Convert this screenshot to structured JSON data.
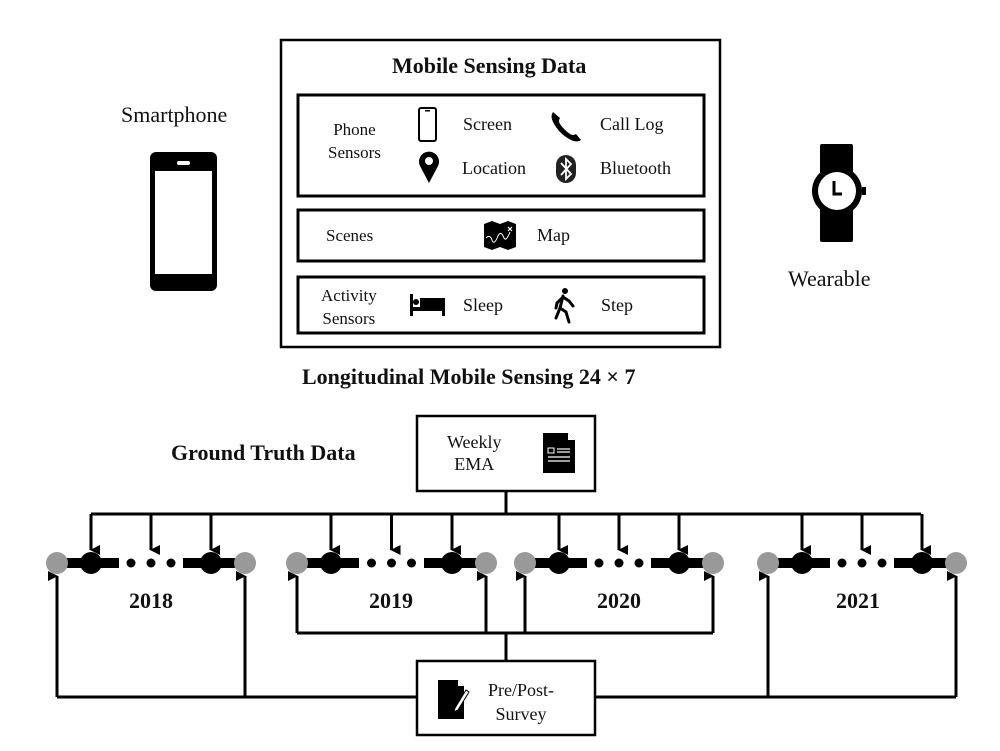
{
  "smartphone": {
    "label": "Smartphone",
    "icon": "smartphone-icon"
  },
  "wearable": {
    "label": "Wearable",
    "icon": "watch-icon"
  },
  "mobile_sensing": {
    "title": "Mobile Sensing Data",
    "groups": [
      {
        "label_lines": [
          "Phone",
          "Sensors"
        ],
        "items": [
          {
            "label": "Screen",
            "icon": "phone-screen-icon"
          },
          {
            "label": "Call Log",
            "icon": "phone-call-icon"
          },
          {
            "label": "Location",
            "icon": "location-pin-icon"
          },
          {
            "label": "Bluetooth",
            "icon": "bluetooth-icon"
          }
        ]
      },
      {
        "label_lines": [
          "Scenes"
        ],
        "items": [
          {
            "label": "Map",
            "icon": "map-icon"
          }
        ]
      },
      {
        "label_lines": [
          "Activity",
          "Sensors"
        ],
        "items": [
          {
            "label": "Sleep",
            "icon": "bed-icon"
          },
          {
            "label": "Step",
            "icon": "walking-icon"
          }
        ]
      }
    ],
    "caption": "Longitudinal Mobile Sensing 24 × 7"
  },
  "ground_truth": {
    "title": "Ground Truth Data",
    "weekly_ema": {
      "lines": [
        "Weekly",
        "EMA"
      ],
      "icon": "document-icon"
    },
    "survey": {
      "lines": [
        "Pre/Post-",
        "Survey"
      ],
      "icon": "edit-document-icon"
    },
    "years": [
      "2018",
      "2019",
      "2020",
      "2021"
    ],
    "colors": {
      "boundary": "#999999",
      "line": "#000000"
    }
  }
}
